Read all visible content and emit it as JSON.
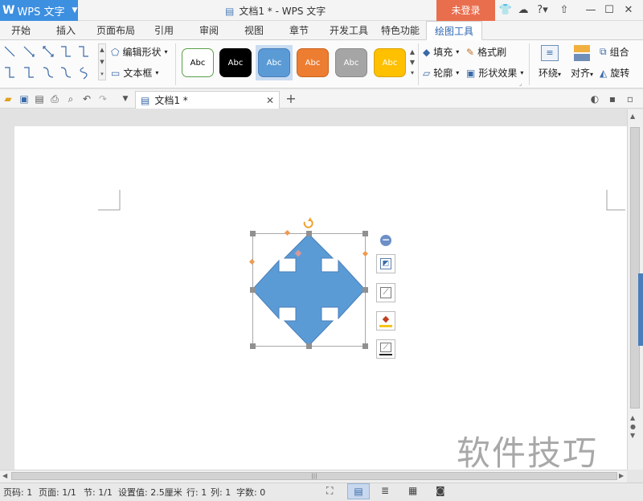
{
  "titlebar": {
    "app_name": "WPS 文字",
    "doc_title": "文档1 * - WPS 文字",
    "login": "未登录",
    "help": "?"
  },
  "tabs": [
    {
      "label": "开始"
    },
    {
      "label": "插入"
    },
    {
      "label": "页面布局"
    },
    {
      "label": "引用"
    },
    {
      "label": "审阅"
    },
    {
      "label": "视图"
    },
    {
      "label": "章节"
    },
    {
      "label": "开发工具"
    },
    {
      "label": "特色功能"
    },
    {
      "label": "绘图工具"
    }
  ],
  "ribbon": {
    "edit_shape": "编辑形状",
    "textbox": "文本框",
    "style_label": "Abc",
    "fill": "填充",
    "format_painter": "格式刷",
    "outline": "轮廓",
    "shape_effect": "形状效果",
    "wrap": "环绕",
    "align": "对齐",
    "group": "组合",
    "rotate": "旋转"
  },
  "styles": [
    {
      "bg": "#ffffff",
      "border": "#5aa04a",
      "fg": "#000000"
    },
    {
      "bg": "#000000",
      "border": "#000000",
      "fg": "#ffffff"
    },
    {
      "bg": "#5b9bd5",
      "border": "#4a7ebb",
      "fg": "#ffffff"
    },
    {
      "bg": "#ed7d31",
      "border": "#c9651f",
      "fg": "#ffffff"
    },
    {
      "bg": "#a5a5a5",
      "border": "#8a8a8a",
      "fg": "#ffffff"
    },
    {
      "bg": "#ffc000",
      "border": "#d9a200",
      "fg": "#ffffff"
    }
  ],
  "document_tab": {
    "name": "文档1 *"
  },
  "shape": {
    "fill": "#5b9bd5",
    "stroke": "#4a7ebb"
  },
  "status": {
    "page_num": "页码: 1",
    "pages": "页面: 1/1",
    "section": "节: 1/1",
    "setting": "设置值: 2.5厘米",
    "row": "行: 1",
    "col": "列: 1",
    "words": "字数: 0"
  },
  "watermark": "软件技巧"
}
